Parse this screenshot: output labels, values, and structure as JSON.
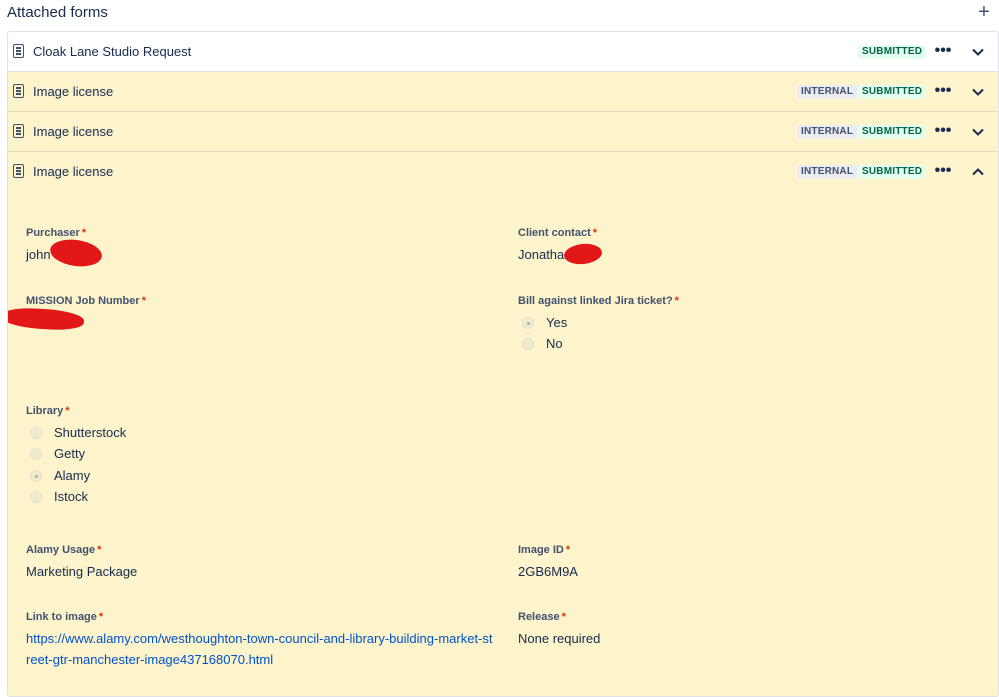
{
  "header": {
    "title": "Attached forms",
    "add_label": "+"
  },
  "forms": [
    {
      "label": "Cloak Lane Studio Request",
      "internal": "",
      "status": "SUBMITTED"
    },
    {
      "label": "Image license",
      "internal": "INTERNAL",
      "status": "SUBMITTED"
    },
    {
      "label": "Image license",
      "internal": "INTERNAL",
      "status": "SUBMITTED"
    },
    {
      "label": "Image license",
      "internal": "INTERNAL",
      "status": "SUBMITTED"
    }
  ],
  "more_glyph": "•••",
  "form_fields": {
    "purchaser": {
      "label": "Purchaser",
      "value": "john"
    },
    "client_contact": {
      "label": "Client contact",
      "value": "Jonathan"
    },
    "mission_job_number": {
      "label": "MISSION Job Number"
    },
    "bill_against": {
      "label": "Bill against linked Jira ticket?",
      "options": [
        "Yes",
        "No"
      ],
      "selected": "Yes"
    },
    "library": {
      "label": "Library",
      "options": [
        "Shutterstock",
        "Getty",
        "Alamy",
        "Istock"
      ],
      "selected": "Alamy"
    },
    "alamy_usage": {
      "label": "Alamy Usage",
      "value": "Marketing Package"
    },
    "image_id": {
      "label": "Image ID",
      "value": "2GB6M9A"
    },
    "link_to_image": {
      "label": "Link to image",
      "value": "https://www.alamy.com/westhoughton-town-council-and-library-building-market-street-gtr-manchester-image437168070.html"
    },
    "release": {
      "label": "Release",
      "value": "None required"
    }
  },
  "required_marker": "*",
  "colors": {
    "panel_bg": "#fdf4cc",
    "submitted_bg": "#e3fcef",
    "submitted_text": "#006644",
    "internal_bg": "#ebecf0",
    "link": "#0052cc",
    "required": "#de350b",
    "redaction": "#e21818"
  }
}
